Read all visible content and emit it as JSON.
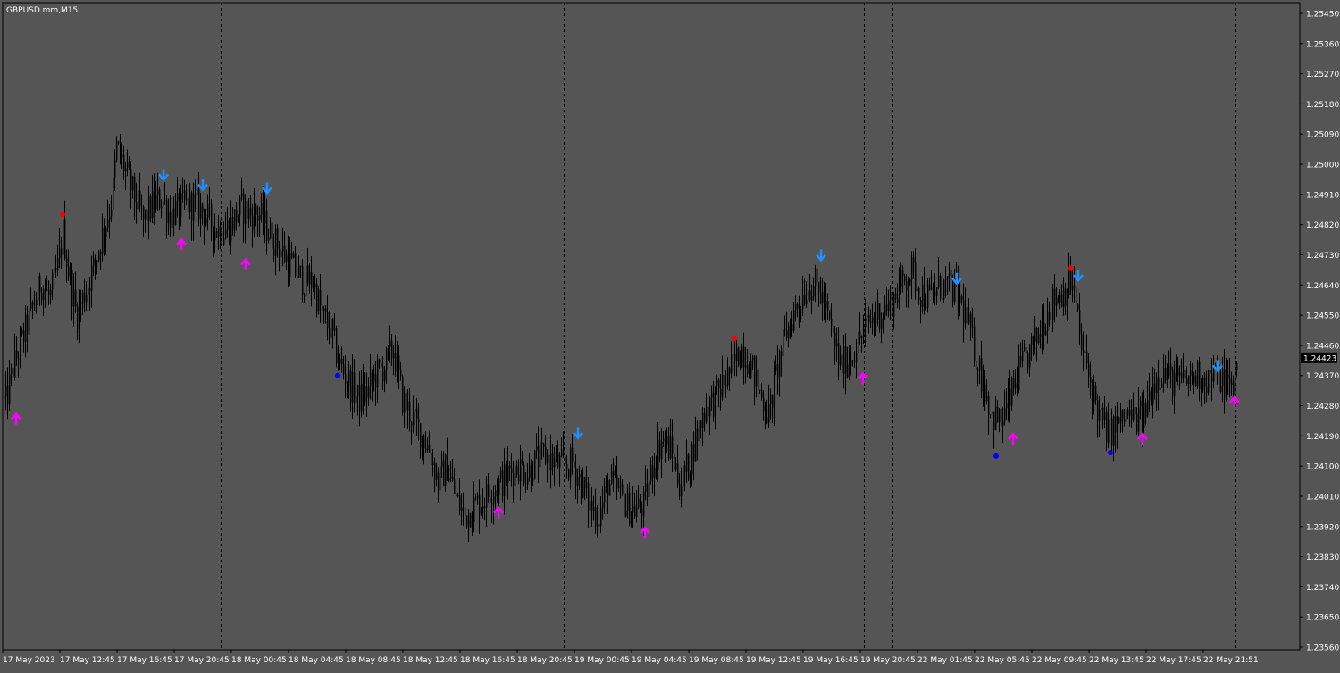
{
  "symbol_label": "GBPUSD.mm,M15",
  "current_price_label": "1.24423",
  "colors": {
    "background": "#555555",
    "axis_text": "#ffffff",
    "candle": "#000000",
    "grid_separator": "#000000",
    "up_arrow": "#ff00ff",
    "down_arrow": "#1e90ff",
    "dot_red": "#ff0000",
    "dot_blue": "#0000ff",
    "price_tag_bg": "#000000"
  },
  "chart_data": {
    "type": "candlestick",
    "title": "GBPUSD.mm,M15",
    "xlabel": "",
    "ylabel": "",
    "ylim": [
      1.2352,
      1.2549
    ],
    "y_ticks": [
      "1.25450",
      "1.25360",
      "1.25270",
      "1.25180",
      "1.25090",
      "1.25000",
      "1.24910",
      "1.24820",
      "1.24730",
      "1.24640",
      "1.24550",
      "1.24460",
      "1.24370",
      "1.24280",
      "1.24190",
      "1.24100",
      "1.24010",
      "1.23920",
      "1.23830",
      "1.23740",
      "1.23650",
      "1.23560"
    ],
    "x_tick_labels": [
      "17 May 2023",
      "17 May 12:45",
      "17 May 16:45",
      "17 May 20:45",
      "18 May 00:45",
      "18 May 04:45",
      "18 May 08:45",
      "18 May 12:45",
      "18 May 16:45",
      "18 May 20:45",
      "19 May 00:45",
      "19 May 04:45",
      "19 May 08:45",
      "19 May 12:45",
      "19 May 16:45",
      "19 May 20:45",
      "22 May 01:45",
      "22 May 05:45",
      "22 May 09:45",
      "22 May 13:45",
      "22 May 17:45",
      "22 May 21:51"
    ],
    "close_path": [
      [
        0,
        1.2434
      ],
      [
        5,
        1.2428
      ],
      [
        15,
        1.244
      ],
      [
        30,
        1.2452
      ],
      [
        45,
        1.2465
      ],
      [
        55,
        1.246
      ],
      [
        65,
        1.247
      ],
      [
        70,
        1.248
      ],
      [
        75,
        1.247
      ],
      [
        85,
        1.2455
      ],
      [
        95,
        1.2462
      ],
      [
        105,
        1.247
      ],
      [
        115,
        1.248
      ],
      [
        125,
        1.249
      ],
      [
        130,
        1.2505
      ],
      [
        140,
        1.2498
      ],
      [
        150,
        1.249
      ],
      [
        160,
        1.2483
      ],
      [
        170,
        1.2488
      ],
      [
        180,
        1.249
      ],
      [
        190,
        1.2485
      ],
      [
        200,
        1.2487
      ],
      [
        210,
        1.2488
      ],
      [
        220,
        1.2488
      ],
      [
        230,
        1.2485
      ],
      [
        240,
        1.2481
      ],
      [
        250,
        1.248
      ],
      [
        260,
        1.2483
      ],
      [
        270,
        1.2487
      ],
      [
        280,
        1.2485
      ],
      [
        290,
        1.2485
      ],
      [
        300,
        1.248
      ],
      [
        310,
        1.2476
      ],
      [
        320,
        1.2472
      ],
      [
        330,
        1.2468
      ],
      [
        340,
        1.2465
      ],
      [
        350,
        1.2465
      ],
      [
        360,
        1.2455
      ],
      [
        370,
        1.245
      ],
      [
        380,
        1.244
      ],
      [
        390,
        1.2435
      ],
      [
        400,
        1.243
      ],
      [
        410,
        1.2432
      ],
      [
        420,
        1.2437
      ],
      [
        430,
        1.244
      ],
      [
        440,
        1.2445
      ],
      [
        450,
        1.243
      ],
      [
        460,
        1.2425
      ],
      [
        470,
        1.242
      ],
      [
        480,
        1.2415
      ],
      [
        490,
        1.2405
      ],
      [
        500,
        1.241
      ],
      [
        510,
        1.24
      ],
      [
        520,
        1.2395
      ],
      [
        530,
        1.2398
      ],
      [
        540,
        1.24
      ],
      [
        550,
        1.2403
      ],
      [
        560,
        1.2405
      ],
      [
        570,
        1.2408
      ],
      [
        580,
        1.241
      ],
      [
        590,
        1.2408
      ],
      [
        600,
        1.2412
      ],
      [
        610,
        1.2413
      ],
      [
        620,
        1.2411
      ],
      [
        630,
        1.241
      ],
      [
        640,
        1.2411
      ],
      [
        650,
        1.2405
      ],
      [
        660,
        1.2398
      ],
      [
        670,
        1.2395
      ],
      [
        680,
        1.2405
      ],
      [
        690,
        1.2403
      ],
      [
        700,
        1.2398
      ],
      [
        710,
        1.2397
      ],
      [
        720,
        1.2398
      ],
      [
        730,
        1.241
      ],
      [
        740,
        1.2418
      ],
      [
        750,
        1.2415
      ],
      [
        760,
        1.2405
      ],
      [
        770,
        1.241
      ],
      [
        780,
        1.242
      ],
      [
        790,
        1.2428
      ],
      [
        800,
        1.243
      ],
      [
        810,
        1.2435
      ],
      [
        820,
        1.244
      ],
      [
        830,
        1.2445
      ],
      [
        840,
        1.244
      ],
      [
        850,
        1.2432
      ],
      [
        860,
        1.2425
      ],
      [
        870,
        1.244
      ],
      [
        880,
        1.245
      ],
      [
        890,
        1.2457
      ],
      [
        900,
        1.2462
      ],
      [
        910,
        1.2465
      ],
      [
        920,
        1.246
      ],
      [
        930,
        1.245
      ],
      [
        940,
        1.244
      ],
      [
        950,
        1.2442
      ],
      [
        960,
        1.2447
      ],
      [
        970,
        1.2452
      ],
      [
        980,
        1.2455
      ],
      [
        990,
        1.2457
      ],
      [
        1000,
        1.246
      ],
      [
        1010,
        1.2465
      ],
      [
        1020,
        1.2468
      ],
      [
        1030,
        1.2462
      ],
      [
        1040,
        1.246
      ],
      [
        1050,
        1.2463
      ],
      [
        1060,
        1.2464
      ],
      [
        1070,
        1.2462
      ],
      [
        1080,
        1.2455
      ],
      [
        1090,
        1.2445
      ],
      [
        1100,
        1.2435
      ],
      [
        1110,
        1.2425
      ],
      [
        1120,
        1.2423
      ],
      [
        1130,
        1.243
      ],
      [
        1140,
        1.2438
      ],
      [
        1150,
        1.2443
      ],
      [
        1160,
        1.2448
      ],
      [
        1170,
        1.2455
      ],
      [
        1180,
        1.246
      ],
      [
        1190,
        1.2462
      ],
      [
        1200,
        1.2465
      ],
      [
        1210,
        1.2445
      ],
      [
        1220,
        1.2435
      ],
      [
        1230,
        1.2425
      ],
      [
        1240,
        1.242
      ],
      [
        1250,
        1.2422
      ],
      [
        1260,
        1.2425
      ],
      [
        1270,
        1.2424
      ],
      [
        1280,
        1.2425
      ],
      [
        1290,
        1.2435
      ],
      [
        1300,
        1.2438
      ],
      [
        1310,
        1.2436
      ],
      [
        1320,
        1.2435
      ],
      [
        1330,
        1.2436
      ],
      [
        1340,
        1.2437
      ],
      [
        1350,
        1.2436
      ],
      [
        1360,
        1.2437
      ],
      [
        1370,
        1.2435
      ],
      [
        1380,
        1.2433
      ],
      [
        1383,
        1.2442
      ]
    ],
    "signals": [
      {
        "type": "up_arrow",
        "x": 18,
        "y": 1.2424
      },
      {
        "type": "dot_red",
        "x": 70,
        "y": 1.2485
      },
      {
        "type": "down_arrow",
        "x": 183,
        "y": 1.2497
      },
      {
        "type": "up_arrow",
        "x": 203,
        "y": 1.2476
      },
      {
        "type": "down_arrow",
        "x": 227,
        "y": 1.2494
      },
      {
        "type": "up_arrow",
        "x": 275,
        "y": 1.247
      },
      {
        "type": "down_arrow",
        "x": 299,
        "y": 1.2493
      },
      {
        "type": "dot_blue",
        "x": 378,
        "y": 1.2437
      },
      {
        "type": "up_arrow",
        "x": 558,
        "y": 1.2396
      },
      {
        "type": "down_arrow",
        "x": 647,
        "y": 1.242
      },
      {
        "type": "up_arrow",
        "x": 722,
        "y": 1.239
      },
      {
        "type": "dot_red",
        "x": 822,
        "y": 1.2448
      },
      {
        "type": "down_arrow",
        "x": 919,
        "y": 1.2473
      },
      {
        "type": "up_arrow",
        "x": 966,
        "y": 1.2436
      },
      {
        "type": "down_arrow",
        "x": 1071,
        "y": 1.2466
      },
      {
        "type": "dot_blue",
        "x": 1115,
        "y": 1.2413
      },
      {
        "type": "up_arrow",
        "x": 1134,
        "y": 1.2418
      },
      {
        "type": "dot_red",
        "x": 1199,
        "y": 1.2469
      },
      {
        "type": "down_arrow",
        "x": 1207,
        "y": 1.2467
      },
      {
        "type": "dot_blue",
        "x": 1243,
        "y": 1.2414
      },
      {
        "type": "up_arrow",
        "x": 1279,
        "y": 1.2418
      },
      {
        "type": "down_arrow",
        "x": 1363,
        "y": 1.244
      },
      {
        "type": "up_arrow",
        "x": 1382,
        "y": 1.2429
      }
    ],
    "session_separators_x": [
      247,
      631,
      967,
      999,
      1383
    ]
  }
}
